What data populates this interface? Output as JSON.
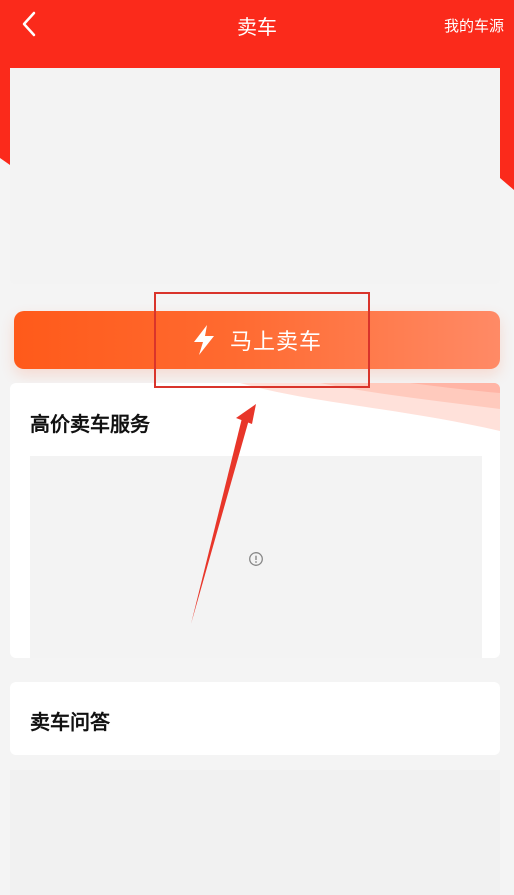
{
  "navbar": {
    "title": "卖车",
    "right_link": "我的车源",
    "back_icon": "chevron-left-icon"
  },
  "sell_button": {
    "label": "马上卖车",
    "icon": "lightning-bolt-icon"
  },
  "service_section": {
    "title": "高价卖车服务",
    "image_status_icon": "info-circle-icon"
  },
  "qa_section": {
    "title": "卖车问答"
  },
  "colors": {
    "header_red": "#fb2a1b",
    "button_orange": "#ff5a1a",
    "button_light": "#ff8a66",
    "annotation_red": "#d9342b",
    "page_bg": "#f4f4f4"
  }
}
